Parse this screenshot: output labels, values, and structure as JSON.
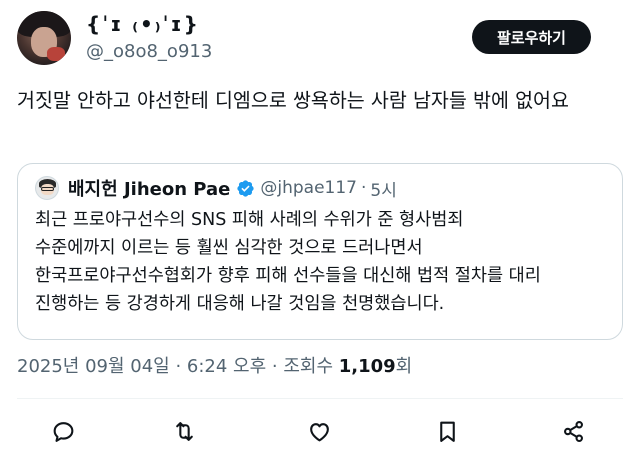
{
  "author": {
    "display_name": "{ˈɪ ₍•₎ˈɪ}",
    "handle": "@_o8o8_o913",
    "avatar": "avatar"
  },
  "follow_label": "팔로우하기",
  "tweet": {
    "text": "거짓말 안하고 야선한테 디엠으로 쌍욕하는 사람 남자들 밖에 없어요"
  },
  "quote": {
    "name": "배지헌 Jiheon Pae",
    "verified_icon": "verified-badge-icon",
    "handle": "@jhpae117",
    "dot": "·",
    "time": "5시",
    "lines": [
      "최근 프로야구선수의 SNS 피해 사례의 수위가 준 형사범죄",
      "수준에까지 이르는 등 훨씬 심각한 것으로 드러나면서",
      "한국프로야구선수협회가 향후 피해 선수들을 대신해 법적 절차를 대리",
      "진행하는 등 강경하게 대응해 나갈 것임을 천명했습니다."
    ]
  },
  "meta": {
    "datetime": "2025년 09월 04일 · 6:24 오후 · 조회수 ",
    "views": "1,109",
    "views_suffix": "회"
  },
  "actions": [
    {
      "icon": "reply-icon"
    },
    {
      "icon": "retweet-icon"
    },
    {
      "icon": "like-icon"
    },
    {
      "icon": "bookmark-icon"
    },
    {
      "icon": "share-icon"
    }
  ],
  "colors": {
    "text": "#0f1419",
    "secondary": "#536471",
    "border": "#cfd9de",
    "verified": "#1d9bf0",
    "button_bg": "#0f1419"
  }
}
